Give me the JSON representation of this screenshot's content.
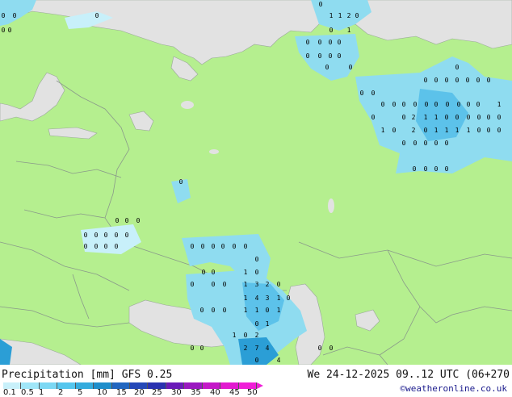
{
  "footer": {
    "title": "Precipitation [mm]  GFS 0.25",
    "validity": "We 24-12-2025 09..12 UTC (06+270",
    "credit": "©weatheronline.co.uk"
  },
  "legend": {
    "ticks": [
      "0.1",
      "0.5",
      "1",
      "2",
      "5",
      "10",
      "15",
      "20",
      "25",
      "30",
      "35",
      "40",
      "45",
      "50"
    ],
    "colors": [
      "#c8f0fa",
      "#a0e6f8",
      "#7cd8f4",
      "#55c6ee",
      "#35acde",
      "#1f8ecb",
      "#2166c0",
      "#2448b8",
      "#2a32b0",
      "#6a1ab8",
      "#9a18c0",
      "#c418c8",
      "#e21ad0",
      "#f020d8"
    ]
  },
  "colors": {
    "land": "#b5ef8f",
    "sea": "#e2e2e2",
    "border": "#8a9a8a",
    "precip_light": "#8fdcf0",
    "precip_mid": "#5cc2ea",
    "precip_strong": "#2b9ed6"
  },
  "map_values": [
    {
      "t": "0"
    },
    {
      "t": "0"
    },
    {
      "t": "0"
    },
    {
      "t": "0"
    },
    {
      "t": "0"
    },
    {
      "t": "0"
    },
    {
      "t": "1"
    },
    {
      "t": "1"
    },
    {
      "t": "2"
    },
    {
      "t": "0"
    },
    {
      "t": "0"
    },
    {
      "t": "1"
    },
    {
      "t": "0"
    },
    {
      "t": "0"
    },
    {
      "t": "0"
    },
    {
      "t": "0"
    },
    {
      "t": "0"
    },
    {
      "t": "0"
    },
    {
      "t": "0"
    },
    {
      "t": "0"
    },
    {
      "t": "0"
    },
    {
      "t": "0"
    },
    {
      "t": "0"
    },
    {
      "t": "0"
    },
    {
      "t": "0"
    },
    {
      "t": "0"
    },
    {
      "t": "0"
    },
    {
      "t": "0"
    },
    {
      "t": "0"
    },
    {
      "t": "0"
    },
    {
      "t": "0"
    },
    {
      "t": "0"
    },
    {
      "t": "0"
    },
    {
      "t": "0"
    },
    {
      "t": "0"
    },
    {
      "t": "0"
    },
    {
      "t": "0"
    },
    {
      "t": "0"
    },
    {
      "t": "0"
    },
    {
      "t": "0"
    },
    {
      "t": "0"
    },
    {
      "t": "0"
    },
    {
      "t": "2"
    },
    {
      "t": "1"
    },
    {
      "t": "1"
    },
    {
      "t": "0"
    },
    {
      "t": "0"
    },
    {
      "t": "0"
    },
    {
      "t": "0"
    },
    {
      "t": "0"
    },
    {
      "t": "0"
    },
    {
      "t": "2"
    },
    {
      "t": "0"
    },
    {
      "t": "1"
    },
    {
      "t": "1"
    },
    {
      "t": "1"
    },
    {
      "t": "1"
    },
    {
      "t": "0"
    },
    {
      "t": "0"
    },
    {
      "t": "0"
    },
    {
      "t": "1"
    },
    {
      "t": "0"
    },
    {
      "t": "0"
    },
    {
      "t": "0"
    },
    {
      "t": "1"
    },
    {
      "t": "0"
    },
    {
      "t": "0"
    },
    {
      "t": "0"
    },
    {
      "t": "0"
    },
    {
      "t": "0"
    },
    {
      "t": "0"
    },
    {
      "t": "0"
    },
    {
      "t": "0"
    },
    {
      "t": "0"
    },
    {
      "t": "0"
    },
    {
      "t": "0"
    },
    {
      "t": "0"
    },
    {
      "t": "0"
    },
    {
      "t": "0"
    },
    {
      "t": "0"
    },
    {
      "t": "0"
    },
    {
      "t": "0"
    },
    {
      "t": "0"
    },
    {
      "t": "0"
    },
    {
      "t": "0"
    },
    {
      "t": "0"
    },
    {
      "t": "0"
    },
    {
      "t": "0"
    },
    {
      "t": "0"
    },
    {
      "t": "0"
    },
    {
      "t": "0"
    },
    {
      "t": "0"
    },
    {
      "t": "0"
    },
    {
      "t": "0"
    },
    {
      "t": "0"
    },
    {
      "t": "0"
    },
    {
      "t": "1"
    },
    {
      "t": "0"
    },
    {
      "t": "0"
    },
    {
      "t": "0"
    },
    {
      "t": "0"
    },
    {
      "t": "1"
    },
    {
      "t": "3"
    },
    {
      "t": "2"
    },
    {
      "t": "0"
    },
    {
      "t": "1"
    },
    {
      "t": "4"
    },
    {
      "t": "3"
    },
    {
      "t": "1"
    },
    {
      "t": "0"
    },
    {
      "t": "0"
    },
    {
      "t": "0"
    },
    {
      "t": "0"
    },
    {
      "t": "1"
    },
    {
      "t": "1"
    },
    {
      "t": "0"
    },
    {
      "t": "1"
    },
    {
      "t": "0"
    },
    {
      "t": "1"
    },
    {
      "t": "1"
    },
    {
      "t": "0"
    },
    {
      "t": "2"
    },
    {
      "t": "0"
    },
    {
      "t": "0"
    },
    {
      "t": "2"
    },
    {
      "t": "7"
    },
    {
      "t": "4"
    },
    {
      "t": "0"
    },
    {
      "t": "0"
    },
    {
      "t": "0"
    },
    {
      "t": "4"
    }
  ]
}
